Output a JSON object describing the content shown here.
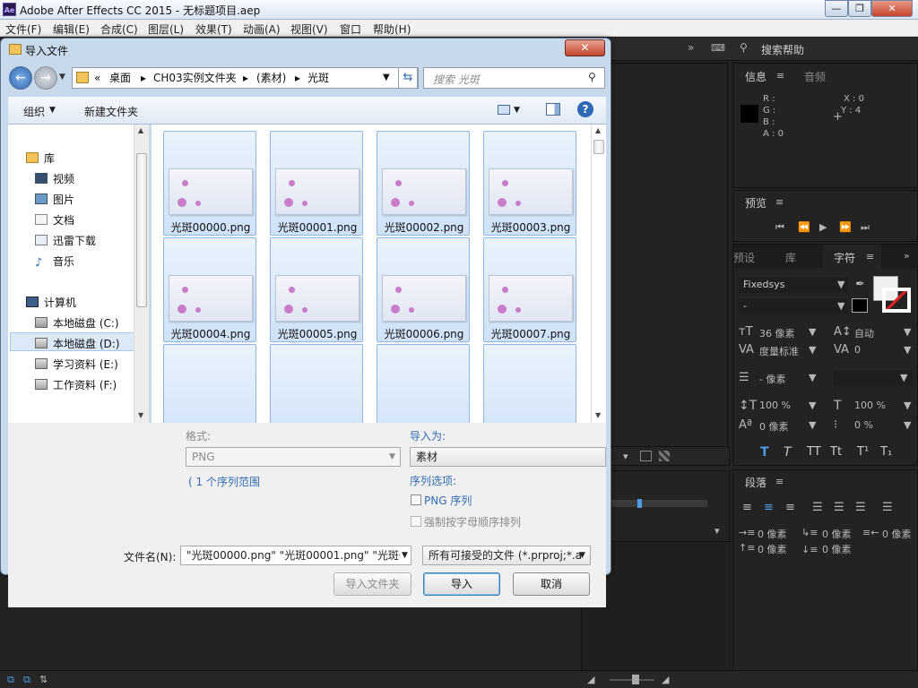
{
  "app": {
    "title": "Adobe After Effects CC 2015 - 无标题项目.aep",
    "logo": "Ae",
    "controls": [
      "—",
      "❐",
      "✕"
    ]
  },
  "menu": [
    "文件(F)",
    "编辑(E)",
    "合成(C)",
    "图层(L)",
    "效果(T)",
    "动画(A)",
    "视图(V)",
    "窗口",
    "帮助(H)"
  ],
  "toolbar_right": {
    "chevron": "»",
    "search_help": "搜索帮助"
  },
  "info_panel": {
    "tabs": [
      "信息",
      "音频"
    ],
    "r": "R :",
    "g": "G :",
    "b": "B :",
    "a": "A : 0",
    "x": "X : 0",
    "y": "Y : 4"
  },
  "preview_panel": {
    "title": "预览"
  },
  "char_panel": {
    "tabs": [
      "预设",
      "库",
      "字符"
    ],
    "font": "Fixedsys",
    "style": "-",
    "size": "36 像素",
    "leading": "自动",
    "kerning": "度量标准",
    "tracking": "0",
    "stroke": "- 像素",
    "vscale": "100 %",
    "hscale": "100 %",
    "baseline": "0 像素",
    "tsume": "0 %",
    "styles": [
      "T",
      "T",
      "TT",
      "Tt",
      "T¹",
      "T₁"
    ]
  },
  "para_panel": {
    "title": "段落",
    "indent_left": "0 像素",
    "indent_first": "0 像素",
    "indent_right": "0 像素",
    "space_before": "0 像素",
    "space_after": "0 像素"
  },
  "dialog": {
    "title": "导入文件",
    "close": "✕",
    "breadcrumb": [
      "桌面",
      "CH03实例文件夹",
      "(素材)",
      "光斑"
    ],
    "search_placeholder": "搜索 光斑",
    "organize": "组织",
    "new_folder": "新建文件夹",
    "nav": [
      {
        "label": "库",
        "group": true
      },
      {
        "label": "视频"
      },
      {
        "label": "图片"
      },
      {
        "label": "文档"
      },
      {
        "label": "迅雷下载"
      },
      {
        "label": "音乐"
      },
      {
        "label": "计算机",
        "group": true
      },
      {
        "label": "本地磁盘 (C:)"
      },
      {
        "label": "本地磁盘 (D:)",
        "selected": true
      },
      {
        "label": "学习资料 (E:)"
      },
      {
        "label": "工作资料 (F:)"
      }
    ],
    "files": [
      "光斑00000.png",
      "光斑00001.png",
      "光斑00002.png",
      "光斑00003.png",
      "光斑00004.png",
      "光斑00005.png",
      "光斑00006.png",
      "光斑00007.png"
    ],
    "format_label": "格式:",
    "format_value": "PNG",
    "sequence_range": "( 1 个序列范围",
    "import_as_label": "导入为:",
    "import_as_value": "素材",
    "sequence_options": "序列选项:",
    "png_sequence": "PNG 序列",
    "force_alpha": "强制按字母顺序排列",
    "filename_label": "文件名(N):",
    "filename_value": "\"光斑00000.png\" \"光斑00001.png\" \"光斑0",
    "filter_value": "所有可接受的文件 (*.prproj;*.a",
    "import_folder": "导入文件夹",
    "import": "导入",
    "cancel": "取消"
  }
}
